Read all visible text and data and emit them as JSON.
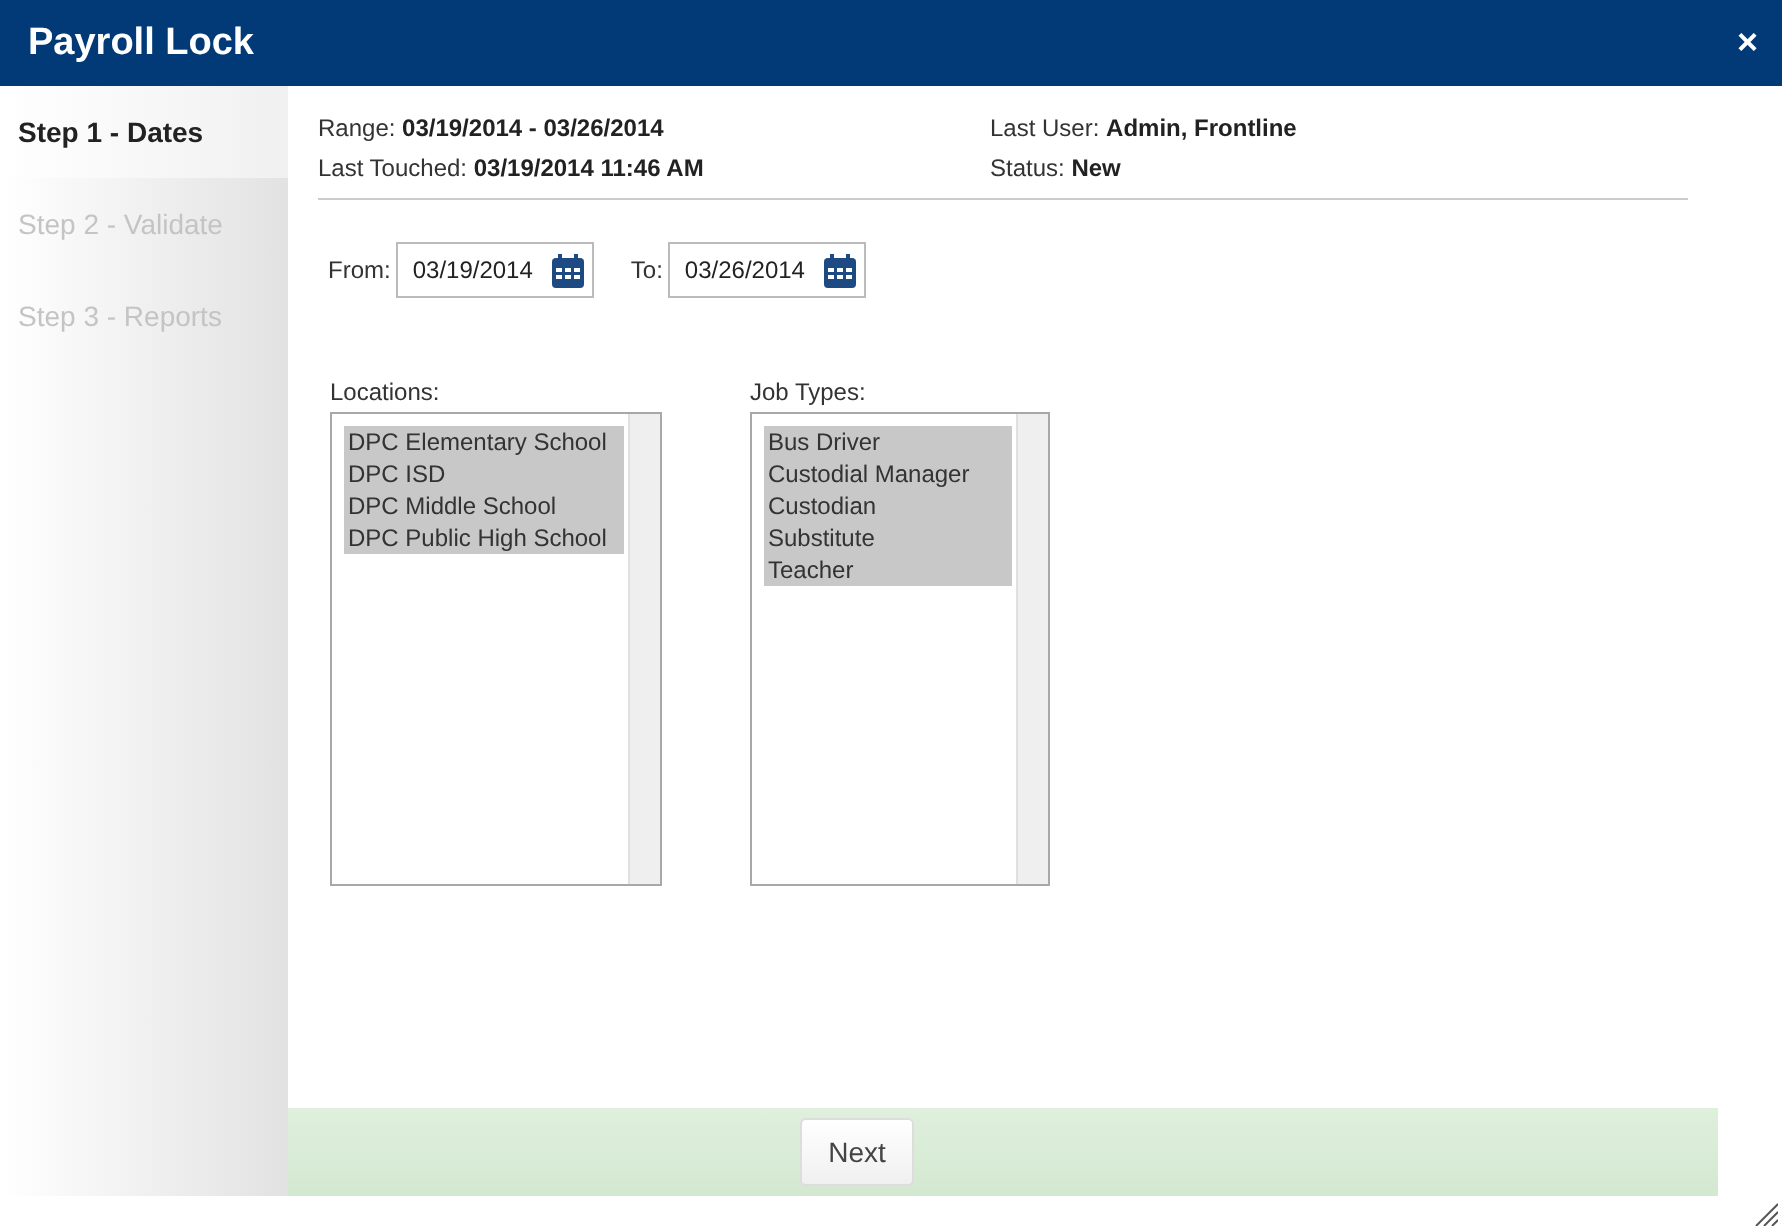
{
  "window": {
    "title": "Payroll Lock",
    "close": "×"
  },
  "steps": [
    {
      "label": "Step 1 - Dates",
      "selected": true
    },
    {
      "label": "Step 2 - Validate",
      "selected": false
    },
    {
      "label": "Step 3 - Reports",
      "selected": false
    }
  ],
  "info_left": [
    {
      "label": "Range:",
      "value": "03/19/2014 - 03/26/2014"
    },
    {
      "label": "Last Touched:",
      "value": "03/19/2014 11:46 AM"
    }
  ],
  "info_right": [
    {
      "label": "Last User:",
      "value": "Admin, Frontline"
    },
    {
      "label": "Status:",
      "value": "New"
    }
  ],
  "dates": [
    {
      "label": "From:",
      "value": "03/19/2014"
    },
    {
      "label": "To:",
      "value": "03/26/2014"
    }
  ],
  "lists": [
    {
      "label": "Locations:",
      "items": [
        {
          "text": "DPC Elementary School",
          "selected": true
        },
        {
          "text": "DPC ISD",
          "selected": true
        },
        {
          "text": "DPC Middle School",
          "selected": true
        },
        {
          "text": "DPC Public High School",
          "selected": true
        }
      ]
    },
    {
      "label": "Job Types:",
      "items": [
        {
          "text": "Bus Driver",
          "selected": true
        },
        {
          "text": "Custodial Manager",
          "selected": true
        },
        {
          "text": "Custodian",
          "selected": true
        },
        {
          "text": "Substitute",
          "selected": true
        },
        {
          "text": "Teacher",
          "selected": true
        }
      ]
    }
  ],
  "buttons": [
    "Next"
  ]
}
